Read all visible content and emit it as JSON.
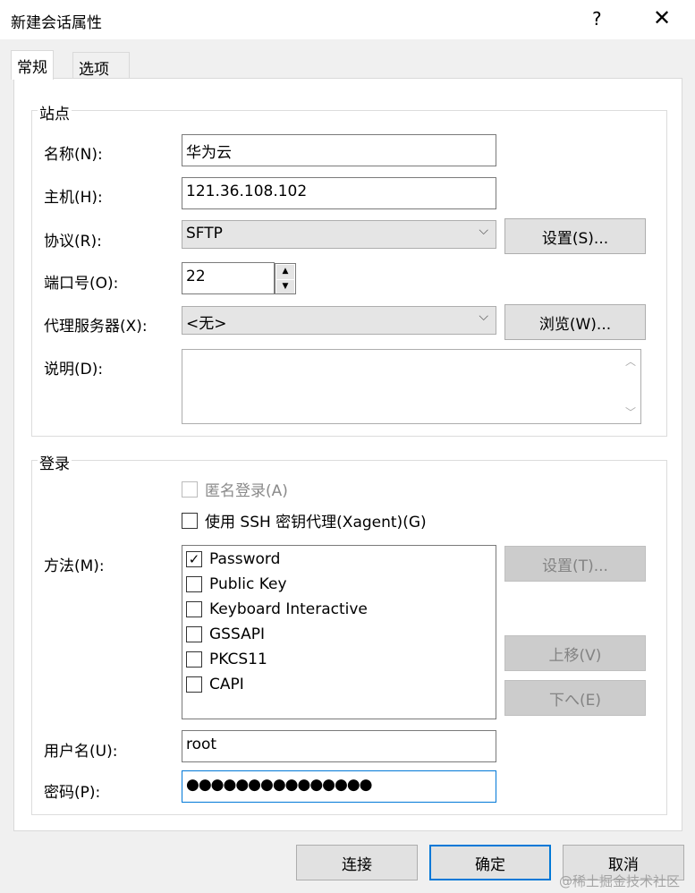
{
  "window": {
    "title": "新建会话属性",
    "help": "?",
    "close": "✕"
  },
  "tabs": [
    {
      "label": "常规"
    },
    {
      "label": "选项"
    }
  ],
  "site": {
    "legend": "站点",
    "name_label": "名称(N):",
    "name_value": "华为云",
    "host_label": "主机(H):",
    "host_value": "121.36.108.102",
    "protocol_label": "协议(R):",
    "protocol_value": "SFTP",
    "settings_button": "设置(S)...",
    "port_label": "端口号(O):",
    "port_value": "22",
    "proxy_label": "代理服务器(X):",
    "proxy_value": "<无>",
    "browse_button": "浏览(W)...",
    "desc_label": "说明(D):",
    "desc_value": ""
  },
  "login": {
    "legend": "登录",
    "anonymous": "匿名登录(A)",
    "ssh_agent": "使用 SSH 密钥代理(Xagent)(G)",
    "method_label": "方法(M):",
    "methods": [
      {
        "label": "Password",
        "checked": true
      },
      {
        "label": "Public Key",
        "checked": false
      },
      {
        "label": "Keyboard Interactive",
        "checked": false
      },
      {
        "label": "GSSAPI",
        "checked": false
      },
      {
        "label": "PKCS11",
        "checked": false
      },
      {
        "label": "CAPI",
        "checked": false
      }
    ],
    "settings_button": "设置(T)...",
    "up_button": "上移(V)",
    "down_button": "下へ(E)",
    "user_label": "用户名(U):",
    "user_value": "root",
    "password_label": "密码(P):",
    "password_value": "●●●●●●●●●●●●●●●"
  },
  "footer": {
    "connect": "连接",
    "ok": "确定",
    "cancel": "取消",
    "watermark": "@稀土掘金技术社区"
  }
}
